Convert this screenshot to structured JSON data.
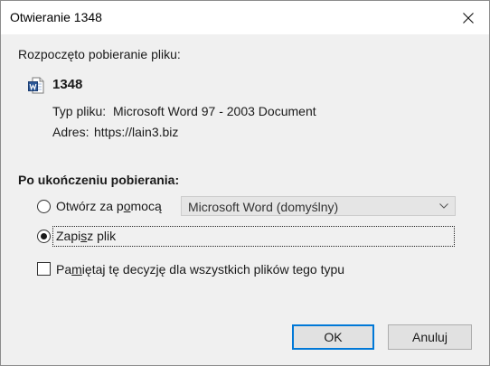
{
  "window": {
    "title": "Otwieranie 1348"
  },
  "download": {
    "intro": "Rozpoczęto pobieranie pliku:",
    "filename": "1348",
    "type_label": "Typ pliku:",
    "type_value": "Microsoft Word 97 - 2003 Document",
    "address_label": "Adres:",
    "address_value": "https://lain3.biz"
  },
  "after": {
    "heading": "Po ukończeniu pobierania:",
    "open_with_pre": "Otwórz za p",
    "open_with_u": "o",
    "open_with_post": "mocą",
    "open_with_app": "Microsoft Word (domyślny)",
    "save_pre": "Zapi",
    "save_u": "s",
    "save_post": "z plik",
    "remember_pre": "Pa",
    "remember_u": "m",
    "remember_post": "iętaj tę decyzję dla wszystkich plików tego typu"
  },
  "state": {
    "selected_action": "save",
    "remember_checked": false
  },
  "buttons": {
    "ok": "OK",
    "cancel": "Anuluj"
  },
  "icons": {
    "close": "close-icon",
    "file": "word-document-icon",
    "dropdown": "chevron-down-icon"
  },
  "colors": {
    "accent": "#0078d7",
    "dialog_bg": "#f0f0f0",
    "titlebar_bg": "#ffffff"
  }
}
